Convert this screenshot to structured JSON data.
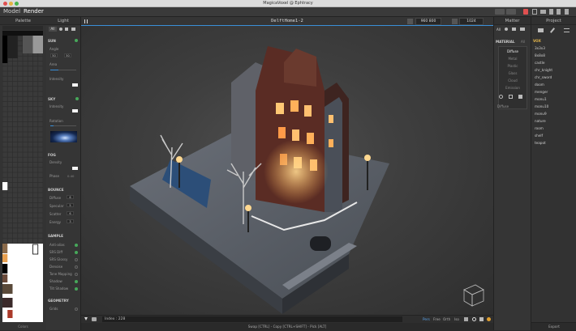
{
  "window": {
    "title": "MagicaVoxel @ Ephtracy"
  },
  "tabs": [
    "Model",
    "Render"
  ],
  "palette": {
    "title": "Palette",
    "footer": "Colors"
  },
  "light_panel": {
    "title": "Light",
    "tab_all": "All",
    "sun": {
      "label": "SUN",
      "angle_label": "Angle",
      "angle_values": [
        "50",
        "50"
      ],
      "area_label": "Area",
      "intensity_label": "Intensity"
    },
    "sky": {
      "label": "SKY",
      "intensity_label": "Intensity",
      "rotation_label": "Rotation"
    },
    "fog": {
      "label": "FOG",
      "density_label": "Density",
      "phase_label": "Phase",
      "phase_value": "0.40"
    },
    "bounce": {
      "label": "BOUNCE",
      "rows": [
        {
          "label": "Diffuse",
          "value": "6"
        },
        {
          "label": "Specular",
          "value": "5"
        },
        {
          "label": "Scatter",
          "value": "6"
        },
        {
          "label": "Energy",
          "value": "3"
        }
      ]
    },
    "sample": {
      "label": "SAMPLE",
      "rows": [
        "Anti-alias",
        "SRS Diff",
        "SRS Glossy",
        "Denoise",
        "Tone Mapping",
        "Shadow",
        "Tilt Shadow"
      ]
    },
    "geometry": {
      "label": "GEOMETRY",
      "rows": [
        "Grids"
      ]
    }
  },
  "viewport": {
    "file_name": "DelftHome1-2",
    "size_w": "960",
    "size_h": "800",
    "sample_count": "1024",
    "index_label": "Index : 228",
    "modes": [
      "Pers",
      "Free",
      "Orth",
      "Iso"
    ],
    "status": "Swap [CTRL] - Copy [CTRL+SHIFT] - Pick [ALT]"
  },
  "matter_panel": {
    "title": "Matter",
    "tab_all": "All",
    "material_label": "MATERIAL",
    "materials": [
      "Diffuse",
      "Metal",
      "Plastic",
      "Glass",
      "Cloud",
      "Emission"
    ],
    "selected_material": "Diffuse",
    "current": "Diffuse"
  },
  "project_panel": {
    "title": "Project",
    "section": "VOX",
    "files": [
      "3x3x3",
      "8x8x8",
      "castle",
      "chr_knight",
      "chr_sword",
      "doom",
      "menger",
      "monu1",
      "monu10",
      "monu9",
      "nature",
      "room",
      "shelf",
      "teapot"
    ],
    "footer": "Export"
  },
  "colors": {
    "accent": "#3a8fd8",
    "check_on": "#47a85a",
    "close": "#e05050"
  }
}
